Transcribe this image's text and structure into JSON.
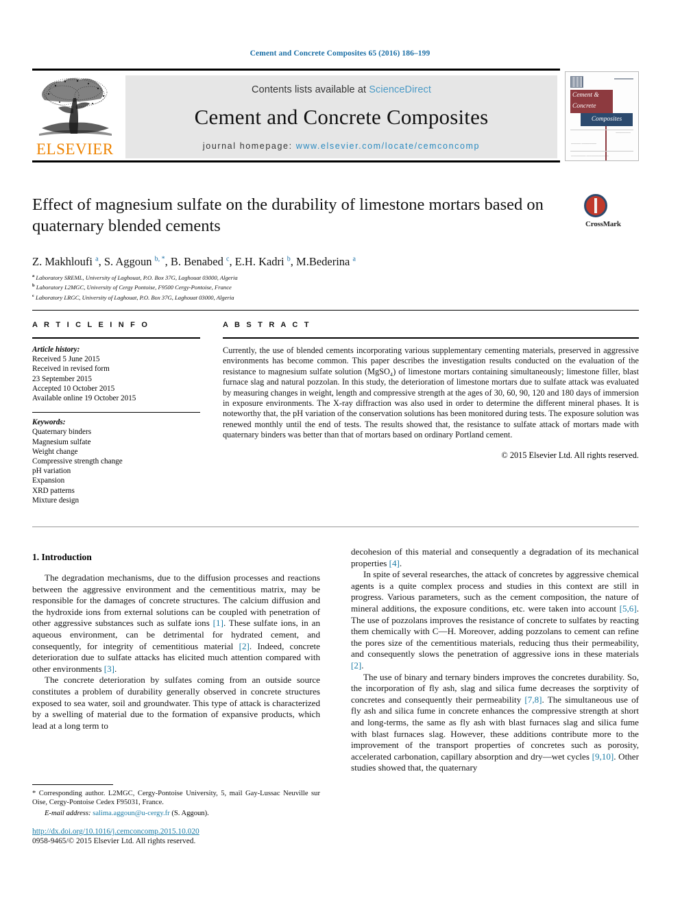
{
  "running_head": "Cement and Concrete Composites 65 (2016) 186–199",
  "masthead": {
    "contents_prefix": "Contents lists available at ",
    "sciencedirect": "ScienceDirect",
    "journal_title": "Cement and Concrete Composites",
    "homepage_prefix": "journal homepage:",
    "homepage_url": "www.elsevier.com/locate/cemconcomp",
    "publisher_wordmark": "ELSEVIER"
  },
  "cover": {
    "line_red_1": "Cement &",
    "line_red_2": "Concrete",
    "line_blue": "Composites",
    "small_a": "——————",
    "small_b": "———— ——————",
    "small_c": "—————— —————————"
  },
  "article": {
    "title": "Effect of magnesium sulfate on the durability of limestone mortars based on quaternary blended cements",
    "authors": [
      {
        "name": "Z. Makhloufi",
        "sup": "a",
        "star": false
      },
      {
        "name": "S. Aggoun",
        "sup": "b",
        "star": true
      },
      {
        "name": "B. Benabed",
        "sup": "c",
        "star": false
      },
      {
        "name": "E.H. Kadri",
        "sup": "b",
        "star": false
      },
      {
        "name": "M.Bederina",
        "sup": "a",
        "star": false
      }
    ],
    "affiliations": [
      {
        "key": "a",
        "text": "Laboratory SREML, University of Laghouat, P.O. Box 37G, Laghouat 03000, Algeria"
      },
      {
        "key": "b",
        "text": "Laboratory L2MGC, University of Cergy Pontoise, F9500 Cergy-Pontoise, France"
      },
      {
        "key": "c",
        "text": "Laboratory LRGC, University of Laghouat, P.O. Box 37G, Laghouat 03000, Algeria"
      }
    ]
  },
  "crossmark": {
    "label": "CrossMark"
  },
  "article_info": {
    "heading": "A R T I C L E   I N F O",
    "history_label": "Article history:",
    "history": [
      "Received 5 June 2015",
      "Received in revised form",
      "23 September 2015",
      "Accepted 10 October 2015",
      "Available online 19 October 2015"
    ],
    "keywords_label": "Keywords:",
    "keywords": [
      "Quaternary binders",
      "Magnesium sulfate",
      "Weight change",
      "Compressive strength change",
      "pH variation",
      "Expansion",
      "XRD patterns",
      "Mixture design"
    ]
  },
  "abstract": {
    "heading": "A B S T R A C T",
    "text": "Currently, the use of blended cements incorporating various supplementary cementing materials, preserved in aggressive environments has become common. This paper describes the investigation results conducted on the evaluation of the resistance to magnesium sulfate solution (MgSO₄) of limestone mortars containing simultaneously; limestone filler, blast furnace slag and natural pozzolan. In this study, the deterioration of limestone mortars due to sulfate attack was evaluated by measuring changes in weight, length and compressive strength at the ages of 30, 60, 90, 120 and 180 days of immersion in exposure environments. The X-ray diffraction was also used in order to determine the different mineral phases. It is noteworthy that, the pH variation of the conservation solutions has been monitored during tests. The exposure solution was renewed monthly until the end of tests. The results showed that, the resistance to sulfate attack of mortars made with quaternary binders was better than that of mortars based on ordinary Portland cement.",
    "copyright": "© 2015 Elsevier Ltd. All rights reserved."
  },
  "body": {
    "section_heading": "1. Introduction",
    "left_paragraphs": [
      "The degradation mechanisms, due to the diffusion processes and reactions between the aggressive environment and the cementitious matrix, may be responsible for the damages of concrete structures. The calcium diffusion and the hydroxide ions from external solutions can be coupled with penetration of other aggressive substances such as sulfate ions [1]. These sulfate ions, in an aqueous environment, can be detrimental for hydrated cement, and consequently, for integrity of cementitious material [2]. Indeed, concrete deterioration due to sulfate attacks has elicited much attention compared with other environments [3].",
      "The concrete deterioration by sulfates coming from an outside source constitutes a problem of durability generally observed in concrete structures exposed to sea water, soil and groundwater. This type of attack is characterized by a swelling of material due to the formation of expansive products, which lead at a long term to"
    ],
    "right_paragraphs": [
      "decohesion of this material and consequently a degradation of its mechanical properties [4].",
      "In spite of several researches, the attack of concretes by aggressive chemical agents is a quite complex process and studies in this context are still in progress. Various parameters, such as the cement composition, the nature of mineral additions, the exposure conditions, etc. were taken into account [5,6]. The use of pozzolans improves the resistance of concrete to sulfates by reacting them chemically with C—H. Moreover, adding pozzolans to cement can refine the pores size of the cementitious materials, reducing thus their permeability, and consequently slows the penetration of aggressive ions in these materials [2].",
      "The use of binary and ternary binders improves the concretes durability. So, the incorporation of fly ash, slag and silica fume decreases the sorptivity of concretes and consequently their permeability [7,8]. The simultaneous use of fly ash and silica fume in concrete enhances the compressive strength at short and long-terms, the same as fly ash with blast furnaces slag and silica fume with blast furnaces slag. However, these additions contribute more to the improvement of the transport properties of concretes such as porosity, accelerated carbonation, capillary absorption and dry—wet cycles [9,10]. Other studies showed that, the quaternary"
    ]
  },
  "footnote": {
    "corresponding": "* Corresponding author. L2MGC, Cergy-Pontoise University, 5, mail Gay-Lussac Neuville sur Oise, Cergy-Pontoise Cedex F95031, France.",
    "email_label": "E-mail address:",
    "email": "salima.aggoun@u-cergy.fr",
    "email_suffix": "(S. Aggoun)."
  },
  "footer": {
    "doi": "http://dx.doi.org/10.1016/j.cemconcomp.2015.10.020",
    "copyright": "0958-9465/© 2015 Elsevier Ltd. All rights reserved."
  },
  "colors": {
    "link": "#1a7ba5",
    "header_blue": "#1a6ea5",
    "elsevier_orange": "#ee8300",
    "masthead_grey": "#e6e6e6"
  }
}
